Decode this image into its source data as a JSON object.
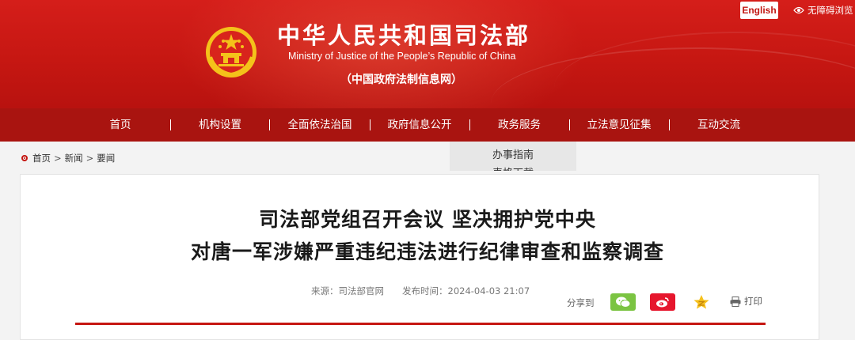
{
  "header": {
    "title_cn": "中华人民共和国司法部",
    "title_en": "Ministry of Justice of the People’s Republic of China",
    "subtitle": "（中国政府法制信息网）",
    "lang_button": "English",
    "accessibility_label": "无障碍浏览"
  },
  "nav": {
    "items": [
      {
        "label": "首页"
      },
      {
        "label": "机构设置"
      },
      {
        "label": "全面依法治国"
      },
      {
        "label": "政府信息公开"
      },
      {
        "label": "政务服务"
      },
      {
        "label": "立法意见征集"
      },
      {
        "label": "互动交流"
      }
    ],
    "dropdown": {
      "items": [
        {
          "label": "办事指南"
        },
        {
          "label": "表格下载"
        }
      ]
    }
  },
  "breadcrumb": {
    "items": [
      "首页",
      "新闻",
      "要闻"
    ],
    "separator": ">"
  },
  "article": {
    "title_line1": "司法部党组召开会议 坚决拥护党中央",
    "title_line2": "对唐一军涉嫌严重违纪违法进行纪律审查和监察调查",
    "source_label": "来源：",
    "source": "司法部官网",
    "published_label": "发布时间：",
    "published": "2024-04-03 21:07",
    "share_label": "分享到",
    "print_label": "打印"
  },
  "colors": {
    "brand_red": "#c51611",
    "nav_red": "#a91410",
    "wechat_green": "#7bc442",
    "weibo_red": "#e6162d",
    "qzone_yellow": "#f6c11c"
  },
  "icons": [
    "national-emblem-icon",
    "eye-icon",
    "location-dot-icon",
    "wechat-icon",
    "weibo-icon",
    "qzone-icon",
    "printer-icon"
  ]
}
